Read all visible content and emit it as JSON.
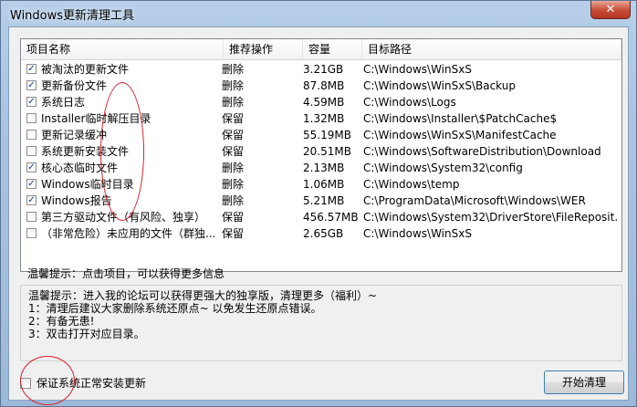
{
  "window": {
    "title": "Windows更新清理工具",
    "close_glyph": "✕"
  },
  "list": {
    "headers": [
      "项目名称",
      "推荐操作",
      "容量",
      "目标路径"
    ],
    "rows": [
      {
        "checked": true,
        "name": "被淘汰的更新文件",
        "action": "删除",
        "size": "3.21GB",
        "path": "C:\\Windows\\WinSxS"
      },
      {
        "checked": true,
        "name": "更新备份文件",
        "action": "删除",
        "size": "87.8MB",
        "path": "C:\\Windows\\WinSxS\\Backup"
      },
      {
        "checked": true,
        "name": "系统日志",
        "action": "删除",
        "size": "4.59MB",
        "path": "C:\\Windows\\Logs"
      },
      {
        "checked": false,
        "name": "Installer临时解压目录",
        "action": "保留",
        "size": "1.32MB",
        "path": "C:\\Windows\\Installer\\$PatchCache$"
      },
      {
        "checked": false,
        "name": "更新记录缓冲",
        "action": "保留",
        "size": "55.19MB",
        "path": "C:\\Windows\\WinSxS\\ManifestCache"
      },
      {
        "checked": false,
        "name": "系统更新安装文件",
        "action": "保留",
        "size": "20.51MB",
        "path": "C:\\Windows\\SoftwareDistribution\\Download"
      },
      {
        "checked": true,
        "name": "核心态临时文件",
        "action": "删除",
        "size": "2.13MB",
        "path": "C:\\Windows\\System32\\config"
      },
      {
        "checked": true,
        "name": "Windows临时目录",
        "action": "删除",
        "size": "1.06MB",
        "path": "C:\\Windows\\temp"
      },
      {
        "checked": true,
        "name": "Windows报告",
        "action": "删除",
        "size": "5.21MB",
        "path": "C:\\ProgramData\\Microsoft\\Windows\\WER"
      },
      {
        "checked": false,
        "name": "第三方驱动文件（有风险、独享）",
        "action": "保留",
        "size": "456.57MB",
        "path": "C:\\Windows\\System32\\DriverStore\\FileReposit..."
      },
      {
        "checked": false,
        "name": "（非常危险）未应用的文件（群独...",
        "action": "保留",
        "size": "2.65GB",
        "path": "C:\\Windows\\WinSxS"
      }
    ]
  },
  "hint": "温馨提示：点击项目，可以获得更多信息",
  "info_lines": [
    "温馨提示：进入我的论坛可以获得更强大的独享版，清理更多（福利）~",
    "1：清理后建议大家删除系统还原点~ 以免发生还原点错误。",
    "2：有备无患!",
    "3：双击打开对应目录。"
  ],
  "bottom": {
    "checkbox_label": "保证系统正常安装更新",
    "checked": false,
    "start_button": "开始清理"
  }
}
